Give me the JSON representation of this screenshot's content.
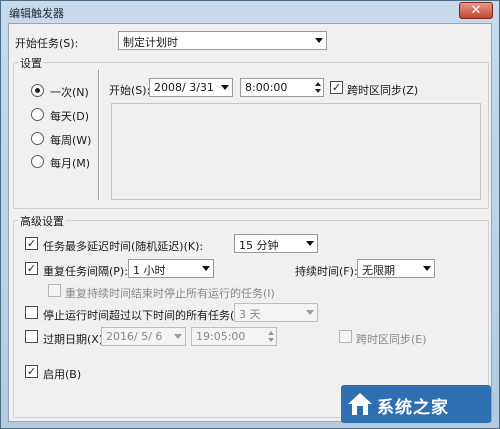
{
  "window": {
    "title": "编辑触发器",
    "close_glyph": "✕"
  },
  "start_task": {
    "label": "开始任务(S):",
    "value": "制定计划时"
  },
  "settings": {
    "legend": "设置",
    "schedule_options": [
      {
        "label": "一次(N)",
        "selected": true
      },
      {
        "label": "每天(D)",
        "selected": false
      },
      {
        "label": "每周(W)",
        "selected": false
      },
      {
        "label": "每月(M)",
        "selected": false
      }
    ],
    "start_label": "开始(S):",
    "start_date": "2008/ 3/31",
    "start_time": "8:00:00",
    "sync_timezone": {
      "label": "跨时区同步(Z)",
      "checked": true
    }
  },
  "advanced": {
    "legend": "高级设置",
    "delay": {
      "label": "任务最多延迟时间(随机延迟)(K):",
      "checked": true,
      "value": "15 分钟"
    },
    "repeat": {
      "label": "重复任务间隔(P):",
      "checked": true,
      "value": "1 小时"
    },
    "duration": {
      "label": "持续时间(F):",
      "value": "无限期"
    },
    "stop_running": {
      "label": "重复持续时间结束时停止所有运行的任务(I)",
      "checked": false
    },
    "stop_longer": {
      "label": "停止运行时间超过以下时间的所有任务(L):",
      "checked": false,
      "value": "3 天"
    },
    "expire": {
      "label": "过期日期(X):",
      "checked": false,
      "date": "2016/ 5/ 6",
      "time": "19:05:00",
      "sync_label": "跨时区同步(E)",
      "sync_checked": false
    },
    "enabled": {
      "label": "启用(B)",
      "checked": true
    }
  },
  "watermark": {
    "text": "系统之家"
  },
  "colors": {
    "accent": "#2d6fb0",
    "close": "#c5452f"
  }
}
